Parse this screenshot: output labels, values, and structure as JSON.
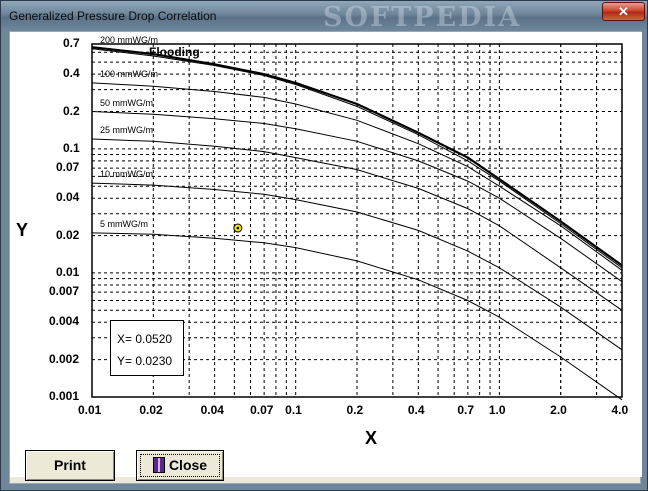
{
  "window": {
    "title": "Generalized Pressure Drop Correlation",
    "watermark": "SOFTPEDIA",
    "close_glyph": "✕"
  },
  "chart_data": {
    "type": "line",
    "xscale": "log",
    "yscale": "log",
    "xlabel": "X",
    "ylabel": "Y",
    "xlim": [
      0.01,
      4.0
    ],
    "ylim": [
      0.001,
      0.7
    ],
    "x_ticks": [
      "0.01",
      "0.02",
      "0.04",
      "0.07",
      "0.1",
      "0.2",
      "0.4",
      "0.7",
      "1.0",
      "2.0",
      "4.0"
    ],
    "y_ticks": [
      "0.7",
      "0.4",
      "0.2",
      "0.1",
      "0.07",
      "0.04",
      "0.02",
      "0.01",
      "0.007",
      "0.004",
      "0.002",
      "0.001"
    ],
    "grid": true,
    "series": [
      {
        "name": "200 mmWG/m",
        "x": [
          0.01,
          0.02,
          0.04,
          0.07,
          0.1,
          0.2,
          0.4,
          0.7,
          1.0,
          2.0,
          4.0
        ],
        "y": [
          0.64,
          0.56,
          0.47,
          0.39,
          0.33,
          0.22,
          0.13,
          0.08,
          0.055,
          0.025,
          0.011
        ]
      },
      {
        "name": "Flooding",
        "x": [
          0.01,
          0.02,
          0.04,
          0.07,
          0.1,
          0.2,
          0.4,
          0.7,
          1.0,
          2.0,
          4.0
        ],
        "y": [
          0.66,
          0.58,
          0.48,
          0.4,
          0.34,
          0.23,
          0.135,
          0.085,
          0.057,
          0.026,
          0.0115
        ]
      },
      {
        "name": "100 mmWG/m",
        "x": [
          0.01,
          0.02,
          0.04,
          0.07,
          0.1,
          0.2,
          0.4,
          0.7,
          1.0,
          2.0,
          4.0
        ],
        "y": [
          0.34,
          0.32,
          0.29,
          0.26,
          0.23,
          0.17,
          0.11,
          0.072,
          0.05,
          0.024,
          0.0105
        ]
      },
      {
        "name": "50 mmWG/m",
        "x": [
          0.01,
          0.02,
          0.04,
          0.07,
          0.1,
          0.2,
          0.4,
          0.7,
          1.0,
          2.0,
          4.0
        ],
        "y": [
          0.2,
          0.19,
          0.175,
          0.16,
          0.145,
          0.115,
          0.08,
          0.055,
          0.04,
          0.019,
          0.0085
        ]
      },
      {
        "name": "25 mmWG/m",
        "x": [
          0.01,
          0.02,
          0.04,
          0.07,
          0.1,
          0.2,
          0.4,
          0.7,
          1.0,
          2.0,
          4.0
        ],
        "y": [
          0.12,
          0.115,
          0.105,
          0.095,
          0.085,
          0.068,
          0.048,
          0.033,
          0.024,
          0.011,
          0.005
        ]
      },
      {
        "name": "10 mmWG/m",
        "x": [
          0.01,
          0.02,
          0.04,
          0.07,
          0.1,
          0.2,
          0.4,
          0.7,
          1.0,
          2.0,
          4.0
        ],
        "y": [
          0.053,
          0.051,
          0.047,
          0.043,
          0.039,
          0.031,
          0.022,
          0.015,
          0.011,
          0.0053,
          0.0024
        ]
      },
      {
        "name": "5 mmWG/m",
        "x": [
          0.01,
          0.02,
          0.04,
          0.07,
          0.1,
          0.2,
          0.4,
          0.7,
          1.0,
          2.0,
          4.0
        ],
        "y": [
          0.021,
          0.0205,
          0.019,
          0.0175,
          0.016,
          0.0125,
          0.0088,
          0.006,
          0.0044,
          0.0021,
          0.00095
        ]
      }
    ],
    "marker": {
      "x": 0.052,
      "y": 0.023
    }
  },
  "readout": {
    "x_text": "X= 0.0520",
    "y_text": "Y= 0.0230"
  },
  "buttons": {
    "print_label": "Print",
    "close_label": "Close"
  }
}
